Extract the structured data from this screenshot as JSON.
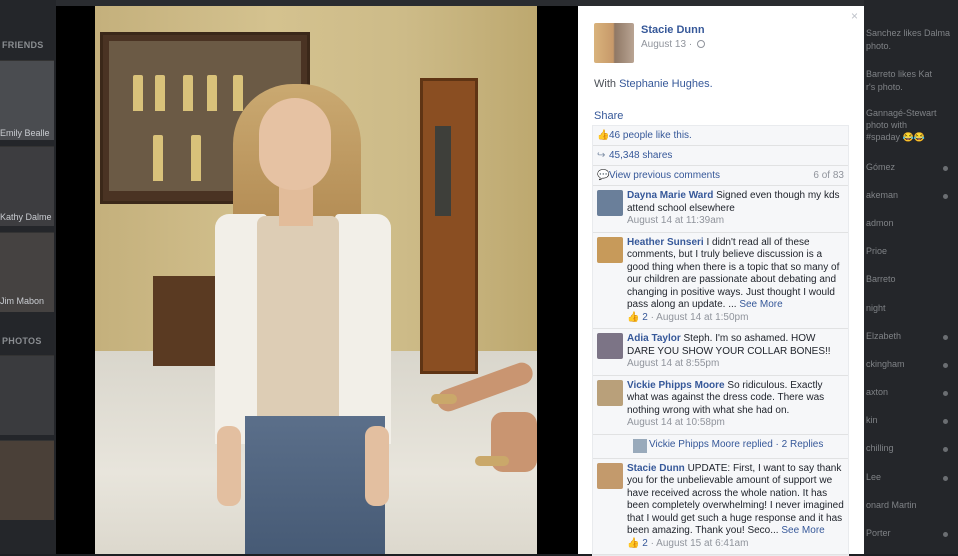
{
  "background": {
    "left_section_friends": "FRIENDS",
    "left_names": [
      "Emily Bealle",
      "Kathy Dalme",
      "Jim Mabon"
    ],
    "left_section_photos": "PHOTOS",
    "right_items": [
      "Sanchez likes Dalma",
      "photo.",
      "Barreto likes Kat",
      "r's photo.",
      "Gannagé-Stewart",
      "photo with",
      "#spaday 😂😂",
      "Gómez",
      "akeman",
      "admon",
      "Prioe",
      "Barreto",
      "night",
      "Elzabeth",
      "ckingham",
      "axton",
      "kin",
      "chilling",
      "Lee",
      "onard Martin",
      "Porter"
    ]
  },
  "post": {
    "close_icon": "×",
    "author": "Stacie Dunn",
    "date": "August 13 ·",
    "with_prefix": "With",
    "with_name": "Stephanie Hughes.",
    "share": "Share",
    "likes": "46 people like this.",
    "shares": "45,348 shares",
    "view_previous": "View previous comments",
    "counter": "6 of 83"
  },
  "comments": [
    {
      "name": "Dayna Marie Ward",
      "text": "Signed even though my kds attend school elsewhere",
      "see_more": "",
      "time": "August 14 at 11:39am",
      "likes": "",
      "avatar_color": "#6a7f9a"
    },
    {
      "name": "Heather Sunseri",
      "text": "I didn't read all of these comments, but I truly believe discussion is a good thing when there is a topic that so many of our children are passionate about debating and changing in positive ways. Just thought I would pass along an update. ...",
      "see_more": "See More",
      "time": "August 14 at 1:50pm",
      "likes": "2",
      "avatar_color": "#c79a5a"
    },
    {
      "name": "Adia Taylor",
      "text": "Steph. I'm so ashamed. HOW DARE YOU SHOW YOUR COLLAR BONES!!",
      "see_more": "",
      "time": "August 14 at 8:55pm",
      "likes": "",
      "avatar_color": "#7c7486"
    },
    {
      "name": "Vickie Phipps Moore",
      "text": "So ridiculous. Exactly what was against the dress code. There was nothing wrong with what she had on.",
      "see_more": "",
      "time": "August 14 at 10:58pm",
      "likes": "",
      "avatar_color": "#b9a07a"
    },
    {
      "name": "Stacie Dunn",
      "text": "UPDATE: First, I want to say thank you for the unbelievable amount of support we have received across the whole nation. It has been completely overwhelming! I never imagined that I would get such a huge response and it has been amazing. Thank you! Seco...",
      "see_more": "See More",
      "time": "August 15 at 6:41am",
      "likes": "2",
      "avatar_color": "#c39a6c"
    }
  ],
  "replies": {
    "text": "Vickie Phipps Moore replied · 2 Replies"
  }
}
